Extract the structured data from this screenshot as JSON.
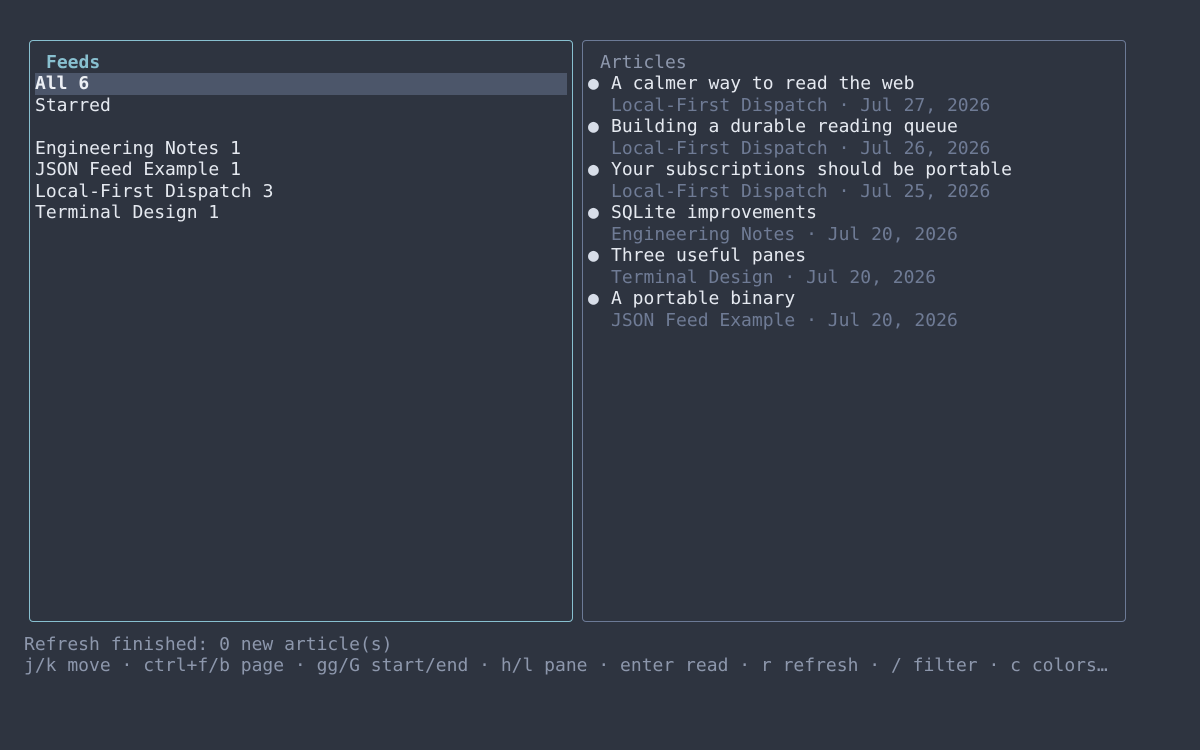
{
  "feeds_pane": {
    "title": "Feeds",
    "items": [
      {
        "label": "All 6",
        "selected": true
      },
      {
        "label": "Starred",
        "selected": false
      }
    ],
    "subscriptions": [
      {
        "label": "Engineering Notes 1"
      },
      {
        "label": "JSON Feed Example 1"
      },
      {
        "label": "Local-First Dispatch 3"
      },
      {
        "label": "Terminal Design 1"
      }
    ]
  },
  "articles_pane": {
    "title": "Articles",
    "bullet": "●",
    "items": [
      {
        "title": "A calmer way to read the web",
        "meta": "Local-First Dispatch · Jul 27, 2026"
      },
      {
        "title": "Building a durable reading queue",
        "meta": "Local-First Dispatch · Jul 26, 2026"
      },
      {
        "title": "Your subscriptions should be portable",
        "meta": "Local-First Dispatch · Jul 25, 2026"
      },
      {
        "title": "SQLite improvements",
        "meta": "Engineering Notes · Jul 20, 2026"
      },
      {
        "title": "Three useful panes",
        "meta": "Terminal Design · Jul 20, 2026"
      },
      {
        "title": "A portable binary",
        "meta": "JSON Feed Example · Jul 20, 2026"
      }
    ]
  },
  "status": {
    "message": "Refresh finished: 0 new article(s)",
    "help": "j/k move · ctrl+f/b page · gg/G start/end · h/l pane · enter read · r refresh · / filter · c colors…"
  },
  "colors": {
    "background": "#2e3440",
    "accent": "#88c0d0",
    "selection": "#4c566a",
    "muted": "#6f7b95"
  }
}
